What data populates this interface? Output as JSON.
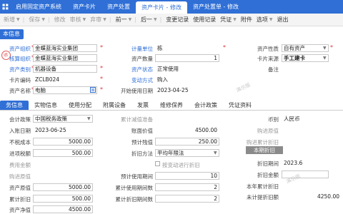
{
  "tabs": [
    {
      "label": "启用固定资产系统"
    },
    {
      "label": "资产卡片"
    },
    {
      "label": "资产处置"
    },
    {
      "label": "资产卡片 - 修改"
    },
    {
      "label": "资产处置单 - 修改"
    }
  ],
  "toolbar": {
    "new": "新增",
    "save": "保存",
    "modify": "修改",
    "review": "审核",
    "unreview": "弃审",
    "prev": "前一",
    "next": "后一",
    "change_record": "变更记录",
    "usage_record": "使用记录",
    "voucher": "凭证",
    "attachment": "附件",
    "options": "选项",
    "exit": "退出"
  },
  "section_basic": "本信息",
  "basic": {
    "owner_org_label": "资产组织",
    "owner_org_value": "金蝶蓝海实业集团",
    "acct_org_label": "核算组织",
    "acct_org_value": "金蝶蓝海实业集团",
    "category_label": "资产类别",
    "category_value": "机器设备",
    "card_no_label": "卡片编码",
    "card_no_value": "ZCLB024",
    "asset_name_label": "资产名称",
    "asset_name_value": "电脑",
    "unit_label": "计量单位",
    "unit_value": "栋",
    "qty_label": "资产数量",
    "qty_value": "1",
    "status_label": "资产状态",
    "status_value": "正常使用",
    "change_label": "变动方式",
    "change_value": "购入",
    "start_date_label": "开始使用日期",
    "start_date_value": "2023-04-25",
    "nature_label": "资产性质",
    "nature_value": "自有资产",
    "source_label": "卡片来源",
    "source_value": "手工建卡",
    "remark_label": "备注",
    "stamp_text": "修"
  },
  "subtabs": [
    "务信息",
    "实物信息",
    "使用分配",
    "附属设备",
    "发票",
    "维修保养",
    "会计政策",
    "凭证资料"
  ],
  "finance": {
    "policy_label": "会计政策",
    "policy_value": "中国税务政策",
    "entry_date_label": "入账日期",
    "entry_date_value": "2023-06-25",
    "orig_cost_label": "不税成本",
    "orig_cost_value": "5000.00",
    "input_tax_label": "进项税额",
    "input_tax_value": "500.00",
    "cost_amount_label": "费用金额",
    "tax_label": "购进原值",
    "asset_orig_label": "资产原值",
    "asset_orig_value": "5000.00",
    "accum_dep_label": "累计折旧",
    "accum_dep_value": "500.00",
    "net_value_label": "资产净值",
    "net_value_value": "4500.00",
    "impair_label": "累计减值准备",
    "book_value_label": "账面价值",
    "book_value_value": "4500.00",
    "salvage_label": "预计残值",
    "salvage_value": "250.00",
    "method_label": "折旧方法",
    "method_value": "平均年限法",
    "by_workload_label": "按变动进行折旧",
    "life_label": "预计使用期间",
    "life_value": "10",
    "used_label": "累计使用期间数",
    "used_value": "2",
    "dep_periods_label": "累计折旧期间数",
    "dep_periods_value": "2",
    "currency_label": "币别",
    "currency_value": "人民币",
    "purchase_orig_label": "购进原值",
    "purchase_dep_label": "购进累计折旧",
    "period_dep_header": "本期折旧",
    "dep_period_label": "折旧期间",
    "dep_period_value": "2023.6",
    "dep_amount_label": "折旧金额",
    "year_dep_label": "本年累计折旧",
    "unprovided_label": "未计提折旧额",
    "unprovided_value": "4250.00"
  },
  "watermarks": [
    "演示版",
    "演示版"
  ]
}
